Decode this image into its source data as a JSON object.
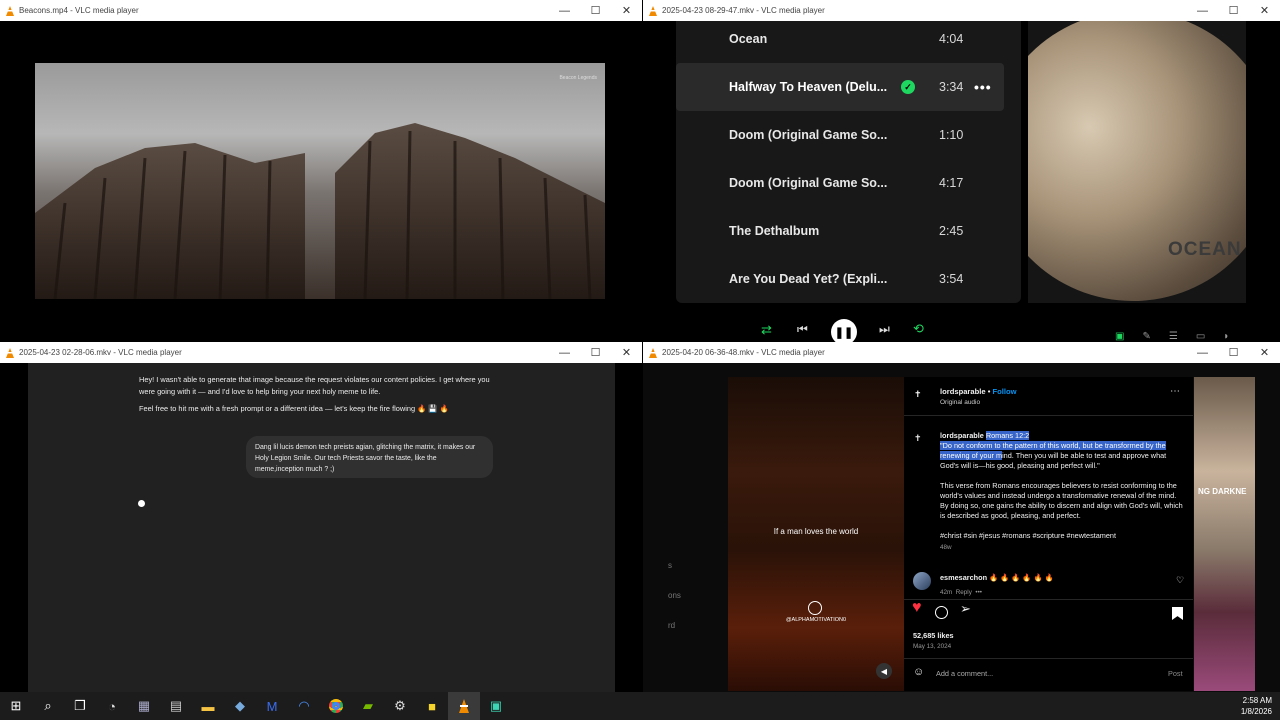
{
  "windows": {
    "top_left": {
      "title": "Beacons.mp4 - VLC media player",
      "watermark": "Beacon Legends"
    },
    "top_right": {
      "title": "2025-04-23 08-29-47.mkv - VLC media player"
    },
    "bottom_left": {
      "title": "2025-04-23 02-28-06.mkv - VLC media player"
    },
    "bottom_right": {
      "title": "2025-04-20 06-36-48.mkv - VLC media player"
    }
  },
  "spotify": {
    "tracks": [
      {
        "name": "Ocean",
        "duration": "4:04"
      },
      {
        "name": "Halfway To Heaven (Delu...",
        "duration": "3:34"
      },
      {
        "name": "Doom (Original Game So...",
        "duration": "1:10"
      },
      {
        "name": "Doom (Original Game So...",
        "duration": "4:17"
      },
      {
        "name": "The Dethalbum",
        "duration": "2:45"
      },
      {
        "name": "Are You Dead Yet? (Expli...",
        "duration": "3:54"
      }
    ],
    "album_text": "OCEAN"
  },
  "chat": {
    "assistant_p1": "Hey! I wasn't able to generate that image because the request violates our content policies. I get where you were going with it — and I'd love to help bring your next holy meme to life.",
    "assistant_p2": "Feel free to hit me with a fresh prompt or a different idea — let's keep the fire flowing 🔥 💾 🔥",
    "user_msg": "Dang lil lucis demon tech preists agian, glitching the matrix, it makes our Holy Legion Smile. Our tech Priests savor the taste, like the meme,inception much ? ;)"
  },
  "instagram": {
    "reel_caption": "If a man loves the world",
    "reel_tag": "@ALPHAMOTIVATION0",
    "side_bits": [
      "s",
      "ons",
      "rd"
    ],
    "username": "lordsparable",
    "follow": "Follow",
    "audio": "Original audio",
    "cap_user": "lordsparable",
    "cap_ref": "Romans 12:2",
    "cap_hl": "\"Do not conform to the pattern of this world, but be transformed by the renewing of your m",
    "cap_rest": "ind. Then you will be able to test and approve what God's will is—his good, pleasing and perfect will.\"",
    "cap_p2": "This verse from Romans encourages believers to resist conforming to the world's values and instead undergo a transformative renewal of the mind. By doing so, one gains the ability to discern and align with God's will, which is described as good, pleasing, and perfect.",
    "tags": "#christ #sin #jesus #romans #scripture #newtestament",
    "age": "48w",
    "commenter": "esmesarchon",
    "comment": "🔥 🔥 🔥 🔥 🔥 🔥",
    "comment_age": "42m",
    "reply": "Reply",
    "likes": "52,685 likes",
    "date": "May 13, 2024",
    "add_comment": "Add a comment...",
    "post": "Post",
    "right_text": "NG DARKNE"
  },
  "taskbar": {
    "time": "2:58 AM",
    "date": "1/8/2026"
  },
  "colors": {
    "spotify_green": "#1ed760",
    "ig_blue": "#0095f6",
    "ig_like": "#ff3040"
  }
}
